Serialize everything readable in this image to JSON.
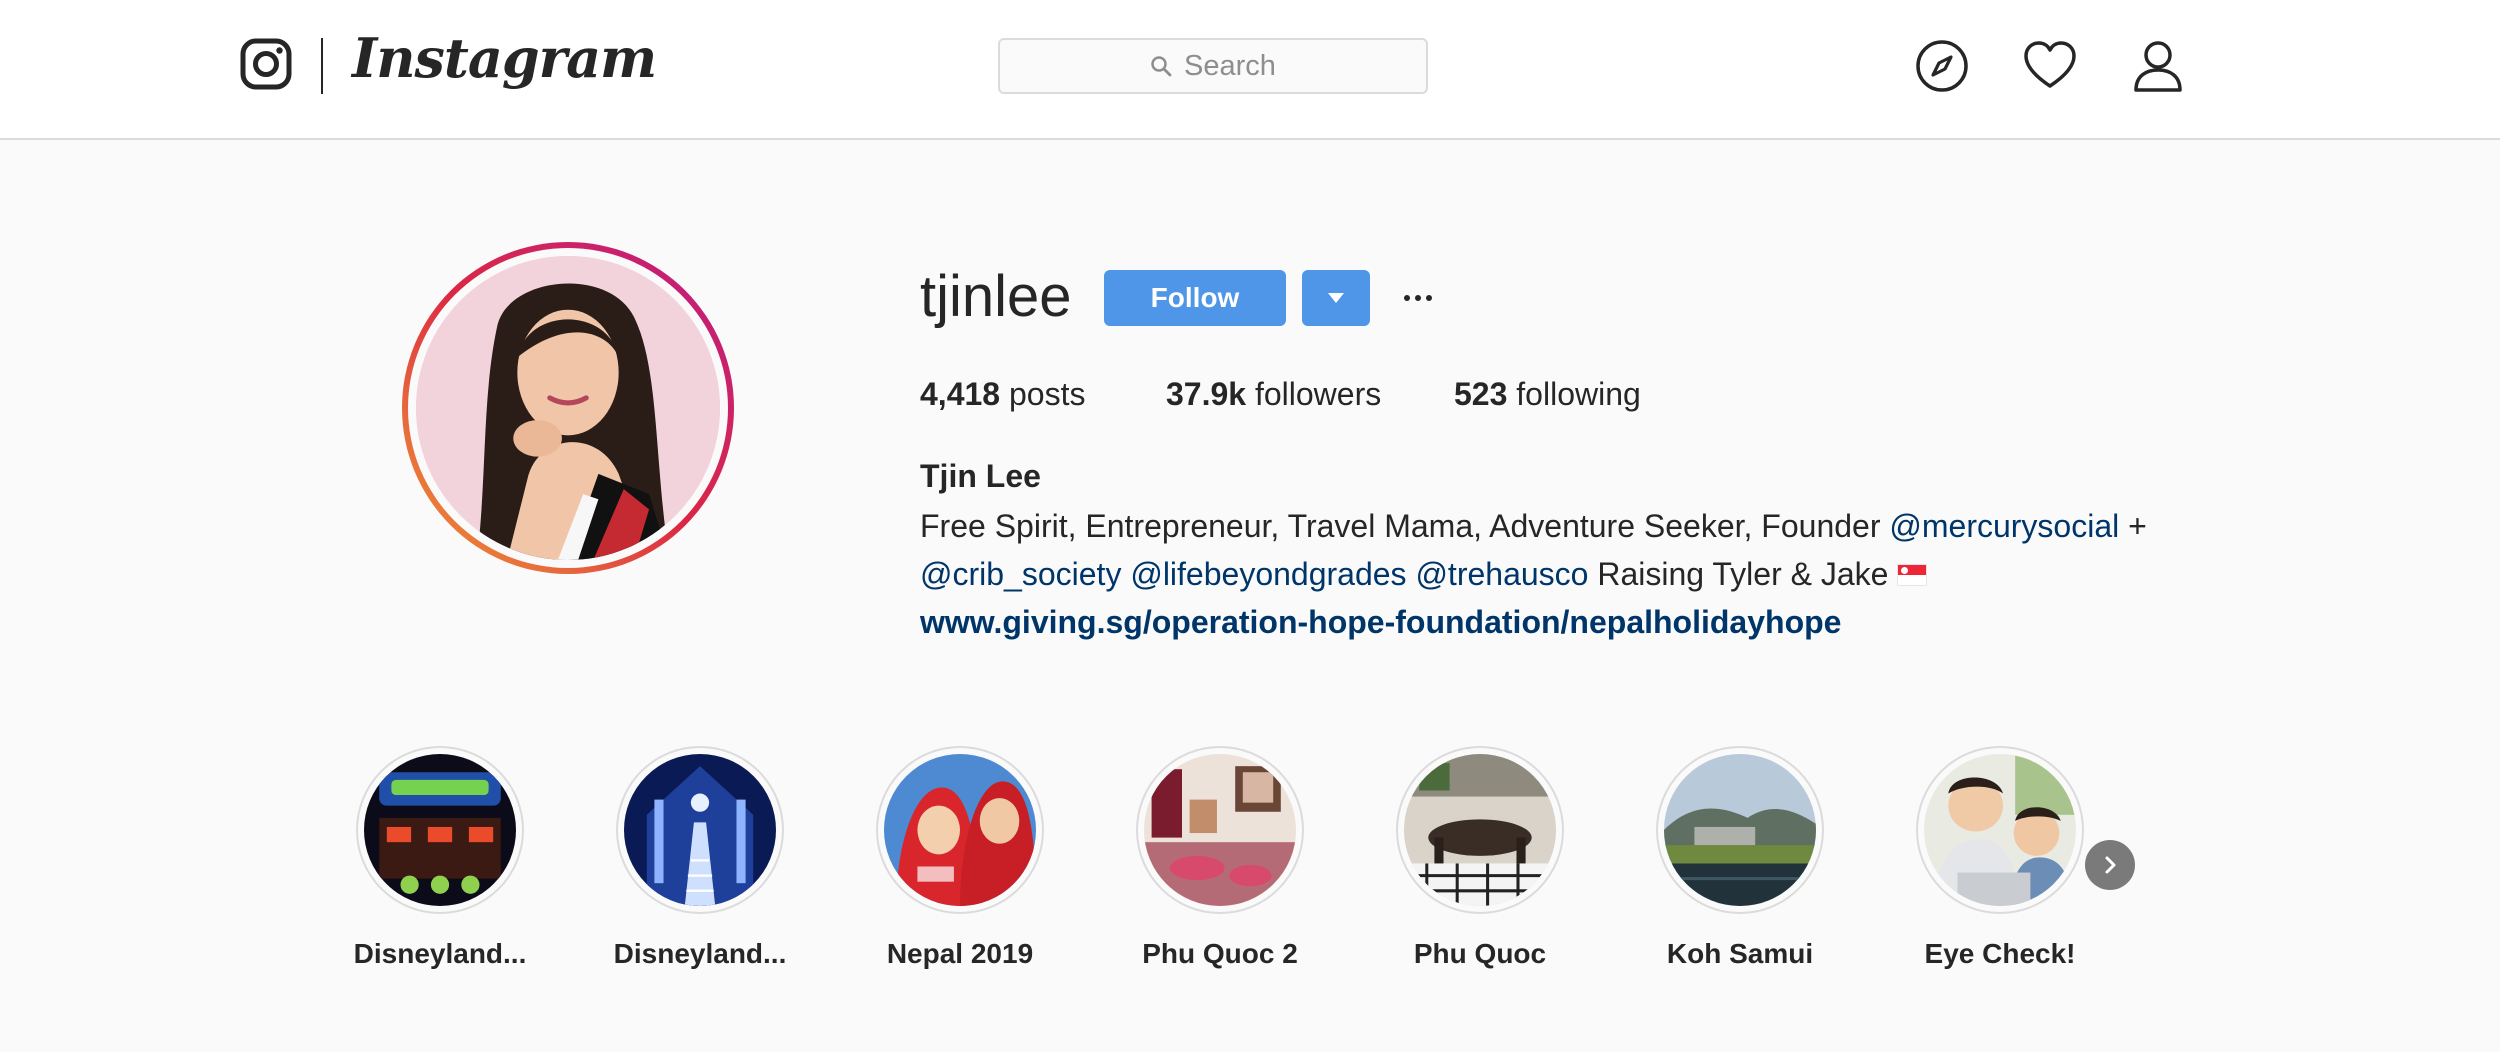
{
  "header": {
    "brand": "Instagram",
    "search": {
      "placeholder": "Search"
    },
    "icons": [
      "compass-icon",
      "heart-icon",
      "user-icon"
    ]
  },
  "profile": {
    "username": "tjinlee",
    "follow_label": "Follow",
    "stats": {
      "posts_count": "4,418",
      "posts_label": "posts",
      "followers_count": "37.9k",
      "followers_label": "followers",
      "following_count": "523",
      "following_label": "following"
    },
    "full_name": "Tjin Lee",
    "bio": {
      "line1_text": "Free Spirit, Entrepreneur, Travel Mama, Adventure Seeker, Founder ",
      "mention1": "@mercurysocial",
      "line1_suffix": " +",
      "mention2": "@crib_society",
      "mention3": "@lifebeyondgrades",
      "mention4": "@trehausco",
      "line2_text": " Raising Tyler & Jake ",
      "link": "www.giving.sg/operation-hope-foundation/nepalholidayhope"
    }
  },
  "highlights": [
    {
      "label": "Disneyland..."
    },
    {
      "label": "Disneyland..."
    },
    {
      "label": "Nepal 2019"
    },
    {
      "label": "Phu Quoc 2"
    },
    {
      "label": "Phu Quoc"
    },
    {
      "label": "Koh Samui"
    },
    {
      "label": "Eye Check!"
    }
  ],
  "colors": {
    "accent": "#4f95e8",
    "link": "#003569",
    "text": "#262626",
    "muted": "#8e8e8e",
    "border": "#dbdbdb",
    "background": "#fafafa"
  }
}
